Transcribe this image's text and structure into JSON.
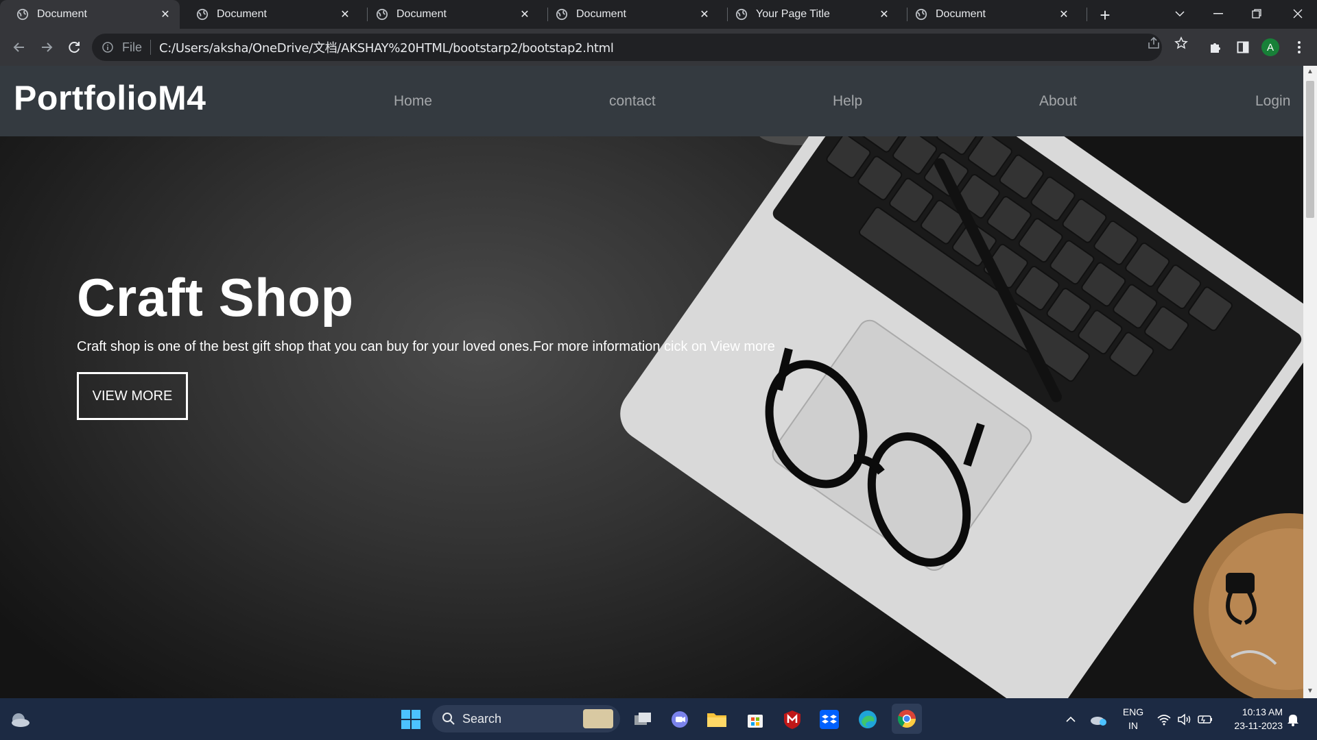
{
  "browser": {
    "tabs": [
      {
        "title": "Document",
        "active": true
      },
      {
        "title": "Document",
        "active": false
      },
      {
        "title": "Document",
        "active": false
      },
      {
        "title": "Document",
        "active": false
      },
      {
        "title": "Your Page Title",
        "active": false
      },
      {
        "title": "Document",
        "active": false
      }
    ],
    "new_tab_icon": "plus-icon",
    "omnibox": {
      "scheme_label": "File",
      "url": "C:/Users/aksha/OneDrive/文档/AKSHAY%20HTML/bootstarp2/bootstap2.html"
    },
    "profile_initial": "A",
    "profile_color": "#188038"
  },
  "page": {
    "brand": "PortfolioM4",
    "nav": [
      "Home",
      "contact",
      "Help",
      "About",
      "Login"
    ],
    "hero": {
      "title": "Craft Shop",
      "subtitle": "Craft shop is one of the best gift shop that you can buy for your loved ones.For more information cick on View more",
      "button": "VIEW MORE"
    },
    "navbar_color": "#343a40"
  },
  "taskbar": {
    "search_placeholder": "Search",
    "language_line1": "ENG",
    "language_line2": "IN",
    "time": "10:13 AM",
    "date": "23-11-2023",
    "background": "#1c2a43"
  }
}
